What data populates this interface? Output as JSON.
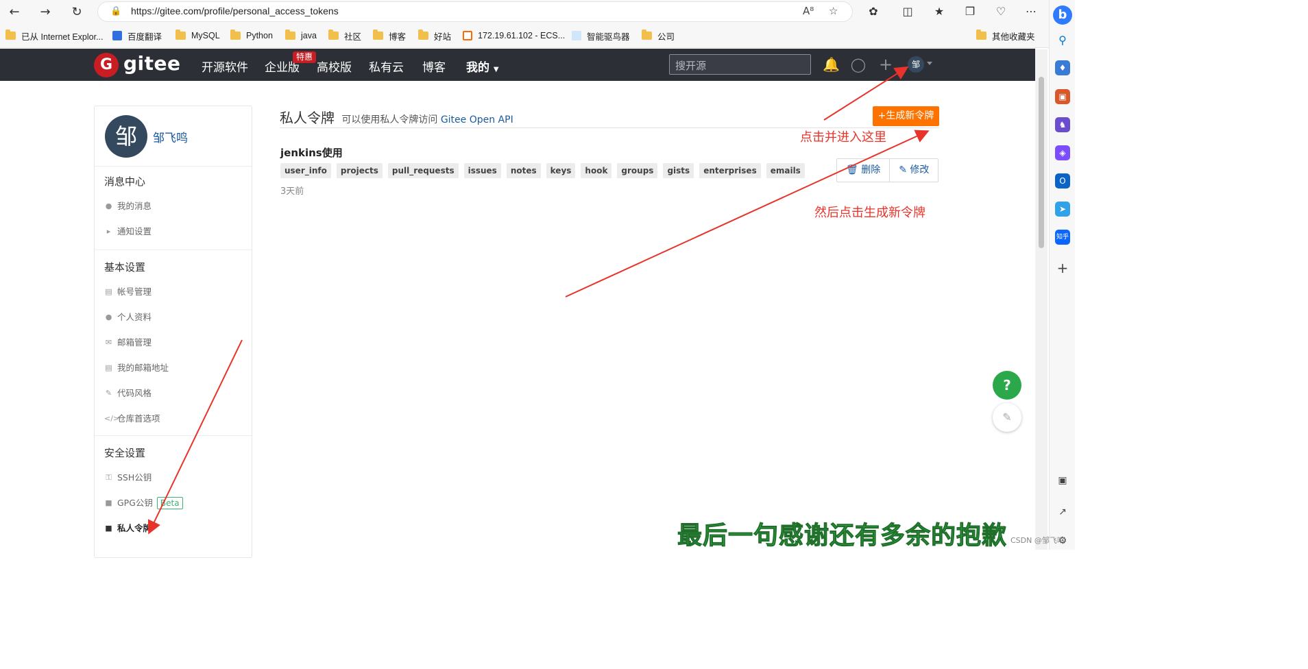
{
  "browser": {
    "url": "https://gitee.com/profile/personal_access_tokens",
    "bookmarks": [
      "已从 Internet Explor...",
      "百度翻译",
      "MySQL",
      "Python",
      "java",
      "社区",
      "博客",
      "好站",
      "172.19.61.102 - ECS...",
      "智能驱鸟器",
      "公司"
    ],
    "bookmarks_other": "其他收藏夹",
    "right_sidebar": {
      "zhihu": "知乎"
    }
  },
  "gitee_nav": {
    "logo": "gitee",
    "items": [
      "开源软件",
      "企业版",
      "高校版",
      "私有云",
      "博客",
      "我的"
    ],
    "hot_badge": "特惠",
    "search_placeholder": "搜开源",
    "avatar_char": "邹"
  },
  "sidebar": {
    "avatar_char": "邹",
    "user_name": "邹飞鸣",
    "sections": [
      {
        "title": "消息中心",
        "items": [
          "我的消息",
          "通知设置"
        ]
      },
      {
        "title": "基本设置",
        "items": [
          "帐号管理",
          "个人资料",
          "邮箱管理",
          "我的邮箱地址",
          "代码风格",
          "仓库首选项"
        ]
      },
      {
        "title": "安全设置",
        "items": [
          "SSH公钥",
          "GPG公钥",
          "私人令牌"
        ]
      }
    ],
    "beta": "Beta"
  },
  "main": {
    "title": "私人令牌",
    "subtitle_prefix": "可以使用私人令牌访问",
    "subtitle_link": "Gitee Open API",
    "generate_button": "+生成新令牌",
    "token": {
      "name": "jenkins使用",
      "scopes": [
        "user_info",
        "projects",
        "pull_requests",
        "issues",
        "notes",
        "keys",
        "hook",
        "groups",
        "gists",
        "enterprises",
        "emails"
      ],
      "time": "3天前",
      "delete_label": "删除",
      "edit_label": "修改"
    }
  },
  "annotations": {
    "enter_here": "点击并进入这里",
    "then_click": "然后点击生成新令牌",
    "bottom_text": "最后一句感谢还有多余的抱歉",
    "watermark": "CSDN @邹飞鸣"
  },
  "colors": {
    "nav_bg": "#2d2f37",
    "accent_orange": "#fe7300",
    "annotation_red": "#e8332a",
    "link_blue": "#1a5aa0"
  }
}
